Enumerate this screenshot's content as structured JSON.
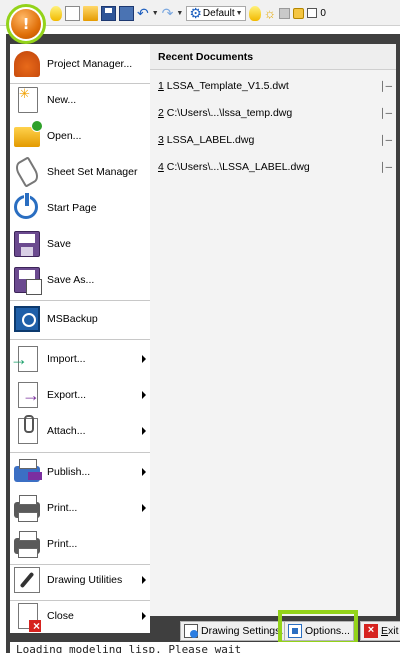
{
  "quick_access_toolbar": {
    "workspace": "Default",
    "value": "0",
    "icons": [
      "lightbulb-icon",
      "new-icon",
      "open-icon",
      "save-icon",
      "save-as-icon",
      "undo-icon",
      "redo-icon",
      "workspace-gear-icon",
      "layer-bulb-icon",
      "sun-icon",
      "lock-icon"
    ]
  },
  "app_button": {
    "glyph": "!"
  },
  "app_menu": {
    "items": [
      {
        "label": "Project Manager...",
        "icon": "project-manager-icon",
        "submenu": false
      },
      {
        "label": "New...",
        "icon": "new-document-icon",
        "submenu": false
      },
      {
        "label": "Open...",
        "icon": "open-folder-icon",
        "submenu": false
      },
      {
        "label": "Sheet Set Manager",
        "icon": "sheet-set-icon",
        "submenu": false
      },
      {
        "label": "Start Page",
        "icon": "power-icon",
        "submenu": false
      },
      {
        "label": "Save",
        "icon": "save-icon",
        "submenu": false
      },
      {
        "label": "Save As...",
        "icon": "save-as-icon",
        "submenu": false
      },
      {
        "label": "MSBackup",
        "icon": "backup-icon",
        "submenu": false
      },
      {
        "label": "Import...",
        "icon": "import-icon",
        "submenu": true
      },
      {
        "label": "Export...",
        "icon": "export-icon",
        "submenu": true
      },
      {
        "label": "Attach...",
        "icon": "attach-icon",
        "submenu": true
      },
      {
        "label": "Publish...",
        "icon": "publish-icon",
        "submenu": true
      },
      {
        "label": "Print...",
        "icon": "printer-icon",
        "submenu": true
      },
      {
        "label": "Print...",
        "icon": "printer-icon",
        "submenu": false
      },
      {
        "label": "Drawing Utilities",
        "icon": "wrench-icon",
        "submenu": true
      },
      {
        "label": "Close",
        "icon": "close-document-icon",
        "submenu": true
      }
    ],
    "recent_documents": {
      "header": "Recent Documents",
      "items": [
        {
          "key": "1",
          "label": " LSSA_Template_V1.5.dwt",
          "pin": "pin-icon"
        },
        {
          "key": "2",
          "label": " C:\\Users\\...\\lssa_temp.dwg",
          "pin": "pin-icon"
        },
        {
          "key": "3",
          "label": " LSSA_LABEL.dwg",
          "pin": "pin-icon"
        },
        {
          "key": "4",
          "label": " C:\\Users\\...\\LSSA_LABEL.dwg",
          "pin": "pin-icon"
        }
      ]
    },
    "footer": {
      "drawing_settings": "Drawing Settings...",
      "options": "Options...",
      "exit_key": "E",
      "exit_rest": "xit"
    }
  },
  "command_line": {
    "text": "Loading modeling lisp. Please wait"
  },
  "colors": {
    "highlight": "#93d31a",
    "menu_frame": "#3f3f3f",
    "app_button": "#e0700a"
  }
}
